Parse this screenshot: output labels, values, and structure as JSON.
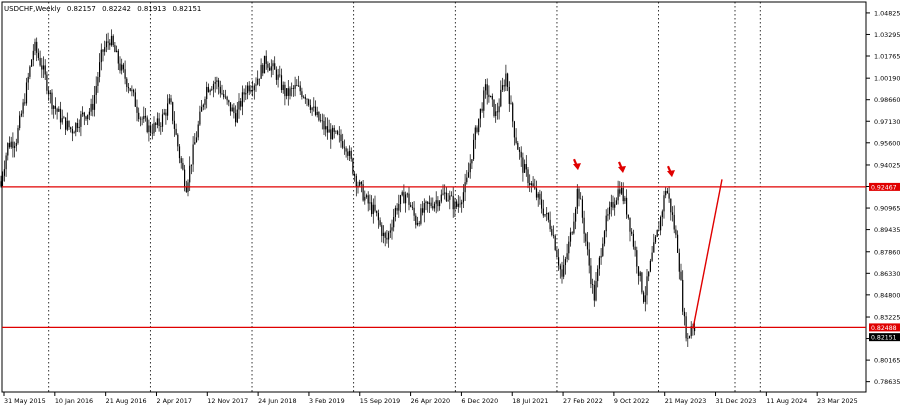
{
  "chart_data": {
    "type": "candlestick",
    "symbol": "USDCHF,Weekly",
    "ohlc_header": [
      "0.82157",
      "0.82242",
      "0.81913",
      "0.82151"
    ],
    "colors": {
      "candle": "#000000",
      "grid": "#000000",
      "axis": "#000000",
      "level_line": "#e00000",
      "arrow": "#e00000",
      "price_box": "#e00000",
      "price_box_text": "#ffffff",
      "text": "#000000"
    },
    "ylim": [
      0.779,
      1.056
    ],
    "price_ticks": [
      "1.04825",
      "1.03295",
      "1.01765",
      "1.00190",
      "0.98660",
      "0.97130",
      "0.95600",
      "0.94025",
      "0.92495",
      "0.90965",
      "0.89435",
      "0.87860",
      "0.86330",
      "0.84800",
      "0.83225",
      "0.81695",
      "0.80165",
      "0.78635"
    ],
    "time_labels": [
      "31 May 2015",
      "10 Jan 2016",
      "21 Aug 2016",
      "2 Apr 2017",
      "12 Nov 2017",
      "24 Jun 2018",
      "3 Feb 2019",
      "15 Sep 2019",
      "26 Apr 2020",
      "6 Dec 2020",
      "18 Jul 2021",
      "27 Feb 2022",
      "9 Oct 2022",
      "21 May 2023",
      "31 Dec 2023",
      "11 Aug 2024",
      "23 Mar 2025"
    ],
    "gridline_after_label": [
      1,
      3,
      5,
      7,
      9,
      11,
      13,
      15
    ],
    "levels": [
      {
        "price": 0.92467,
        "label": "0.92467"
      },
      {
        "price": 0.82488,
        "label": "0.82488"
      }
    ],
    "current_price": {
      "price": 0.82151,
      "label": "0.82151"
    },
    "price_path": [
      [
        0,
        0.925
      ],
      [
        8,
        0.955
      ],
      [
        16,
        0.958
      ],
      [
        24,
        0.985
      ],
      [
        34,
        1.025
      ],
      [
        42,
        1.01
      ],
      [
        52,
        0.985
      ],
      [
        62,
        0.972
      ],
      [
        72,
        0.965
      ],
      [
        82,
        0.975
      ],
      [
        92,
        0.98
      ],
      [
        102,
        1.02
      ],
      [
        110,
        1.03
      ],
      [
        120,
        1.01
      ],
      [
        130,
        0.995
      ],
      [
        140,
        0.975
      ],
      [
        150,
        0.965
      ],
      [
        160,
        0.97
      ],
      [
        170,
        0.985
      ],
      [
        180,
        0.945
      ],
      [
        186,
        0.925
      ],
      [
        196,
        0.96
      ],
      [
        206,
        0.995
      ],
      [
        216,
        1.0
      ],
      [
        226,
        0.985
      ],
      [
        236,
        0.975
      ],
      [
        246,
        0.995
      ],
      [
        256,
        1.0
      ],
      [
        266,
        1.015
      ],
      [
        276,
        1.005
      ],
      [
        286,
        0.99
      ],
      [
        296,
        0.995
      ],
      [
        306,
        0.99
      ],
      [
        316,
        0.975
      ],
      [
        326,
        0.965
      ],
      [
        336,
        0.96
      ],
      [
        346,
        0.955
      ],
      [
        356,
        0.93
      ],
      [
        366,
        0.915
      ],
      [
        376,
        0.905
      ],
      [
        386,
        0.885
      ],
      [
        396,
        0.91
      ],
      [
        406,
        0.92
      ],
      [
        416,
        0.9
      ],
      [
        426,
        0.91
      ],
      [
        436,
        0.915
      ],
      [
        446,
        0.92
      ],
      [
        456,
        0.91
      ],
      [
        466,
        0.925
      ],
      [
        476,
        0.965
      ],
      [
        486,
        0.995
      ],
      [
        496,
        0.975
      ],
      [
        506,
        1.005
      ],
      [
        514,
        0.965
      ],
      [
        522,
        0.94
      ],
      [
        532,
        0.925
      ],
      [
        542,
        0.91
      ],
      [
        552,
        0.895
      ],
      [
        562,
        0.86
      ],
      [
        572,
        0.895
      ],
      [
        578,
        0.925
      ],
      [
        586,
        0.885
      ],
      [
        594,
        0.845
      ],
      [
        604,
        0.895
      ],
      [
        614,
        0.915
      ],
      [
        620,
        0.925
      ],
      [
        628,
        0.905
      ],
      [
        636,
        0.875
      ],
      [
        644,
        0.845
      ],
      [
        652,
        0.875
      ],
      [
        660,
        0.9
      ],
      [
        666,
        0.925
      ],
      [
        672,
        0.905
      ],
      [
        678,
        0.88
      ],
      [
        684,
        0.83
      ],
      [
        688,
        0.815
      ],
      [
        692,
        0.83
      ],
      [
        695,
        0.822
      ]
    ],
    "forecast_line": {
      "from": [
        693,
        0.824
      ],
      "to": [
        722,
        0.93
      ]
    },
    "arrows": [
      {
        "x": 577,
        "price": 0.938
      },
      {
        "x": 622,
        "price": 0.936
      },
      {
        "x": 671,
        "price": 0.933
      }
    ]
  }
}
